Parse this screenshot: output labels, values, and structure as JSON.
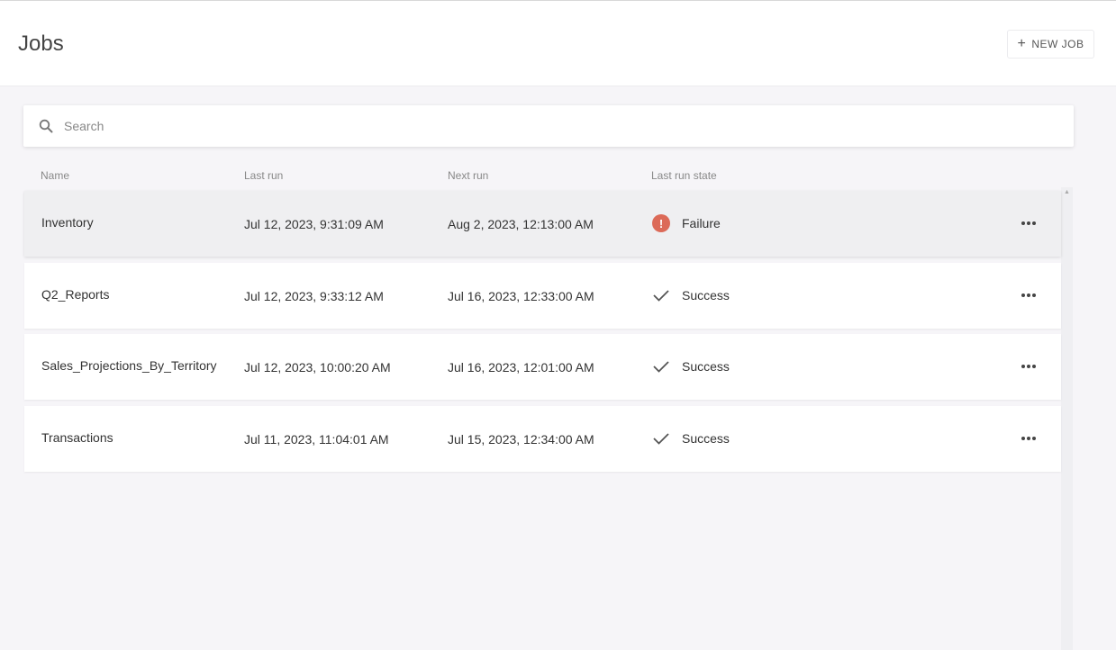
{
  "header": {
    "title": "Jobs",
    "new_job_label": "NEW JOB"
  },
  "search": {
    "placeholder": "Search",
    "value": ""
  },
  "columns": {
    "name": "Name",
    "last_run": "Last run",
    "next_run": "Next run",
    "last_run_state": "Last run state"
  },
  "jobs": [
    {
      "name": "Inventory",
      "last_run": "Jul 12, 2023, 9:31:09 AM",
      "next_run": "Aug 2, 2023, 12:13:00 AM",
      "state": "Failure",
      "state_icon": "alert-icon"
    },
    {
      "name": "Q2_Reports",
      "last_run": "Jul 12, 2023, 9:33:12 AM",
      "next_run": "Jul 16, 2023, 12:33:00 AM",
      "state": "Success",
      "state_icon": "check-icon"
    },
    {
      "name": "Sales_Projections_By_Territory",
      "last_run": "Jul 12, 2023, 10:00:20 AM",
      "next_run": "Jul 16, 2023, 12:01:00 AM",
      "state": "Success",
      "state_icon": "check-icon"
    },
    {
      "name": "Transactions",
      "last_run": "Jul 11, 2023, 11:04:01 AM",
      "next_run": "Jul 15, 2023, 12:34:00 AM",
      "state": "Success",
      "state_icon": "check-icon"
    }
  ],
  "colors": {
    "failure": "#dc6a58",
    "background": "#f6f5f8",
    "selected_row": "#efeff1"
  }
}
